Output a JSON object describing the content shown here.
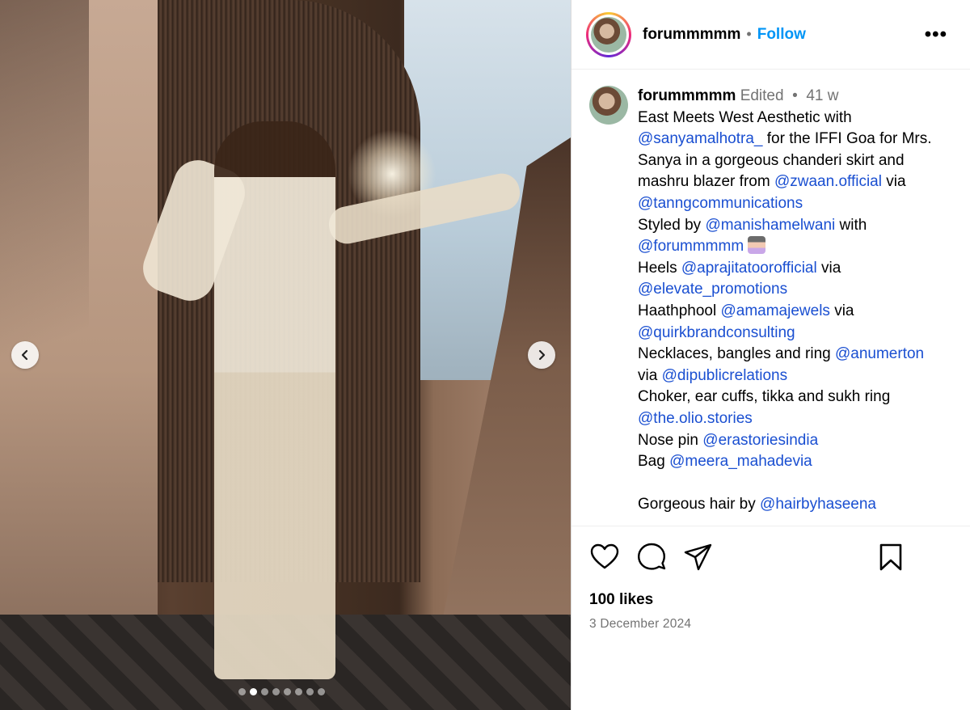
{
  "post": {
    "username": "forummmmm",
    "follow_label": "Follow",
    "more_label": "•••",
    "edited_label": "Edited",
    "age": "41 w"
  },
  "carousel": {
    "slide_count": 8,
    "active_index": 1,
    "prev_icon": "chevron-left-icon",
    "next_icon": "chevron-right-icon"
  },
  "caption": {
    "t1": "East Meets West Aesthetic with",
    "m1": "@sanyamalhotra_",
    "t2": " for the IFFI Goa for Mrs.",
    "t3": "Sanya in a gorgeous chanderi skirt and mashru blazer from ",
    "m2": "@zwaan.official",
    "t4": " via",
    "m3": "@tanngcommunications",
    "t5": "Styled by ",
    "m4": "@manishamelwani",
    "t6": " with",
    "m5": "@forummmmm",
    "t7": "Heels ",
    "m6": "@aprajitatoorofficial",
    "t8": " via",
    "m7": "@elevate_promotions",
    "t9": "Haathphool ",
    "m8": "@amamajewels",
    "t10": " via",
    "m9": "@quirkbrandconsulting",
    "t11": "Necklaces, bangles and ring ",
    "m10": "@anumerton",
    "t12": "via ",
    "m11": "@dipublicrelations",
    "t13": "Choker, ear cuffs, tikka and sukh ring",
    "m12": "@the.olio.stories",
    "t14": "Nose pin ",
    "m13": "@erastoriesindia",
    "t15": "Bag ",
    "m14": "@meera_mahadevia",
    "t16": "Gorgeous hair by ",
    "m15": "@hairbyhaseena"
  },
  "actions": {
    "like_icon": "heart-icon",
    "comment_icon": "comment-icon",
    "share_icon": "send-icon",
    "save_icon": "bookmark-icon"
  },
  "likes": "100 likes",
  "date": "3 December 2024",
  "colors": {
    "link": "#1a4fd1",
    "follow": "#0095f6",
    "muted": "#737373"
  }
}
